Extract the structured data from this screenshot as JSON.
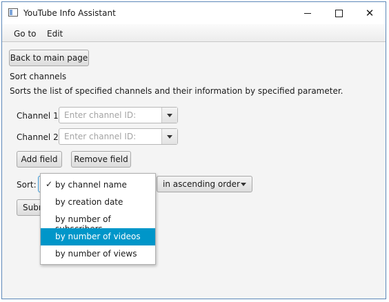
{
  "window": {
    "title": "YouTube Info Assistant",
    "controls": {
      "minimize": "—",
      "maximize": "☐",
      "close": "✕"
    }
  },
  "menu": {
    "items": [
      "Go to",
      "Edit"
    ]
  },
  "page": {
    "back_button": "Back to main page",
    "heading": "Sort channels",
    "description": "Sorts the list of specified channels and their information by specified parameter.",
    "channels": [
      {
        "label": "Channel 1:",
        "placeholder": "Enter channel ID:"
      },
      {
        "label": "Channel 2:",
        "placeholder": "Enter channel ID:"
      }
    ],
    "add_field": "Add field",
    "remove_field": "Remove field",
    "sort_label": "Sort:",
    "order_select": "in ascending order",
    "submit_partial": "Subr"
  },
  "sort_dropdown": {
    "checked_index": 0,
    "selected_index": 3,
    "check_mark": "✓",
    "options": [
      "by channel name",
      "by creation date",
      "by number of subscribers",
      "by number of videos",
      "by number of views"
    ]
  },
  "colors": {
    "highlight": "#0096c9",
    "window_border": "#5b87b8"
  }
}
